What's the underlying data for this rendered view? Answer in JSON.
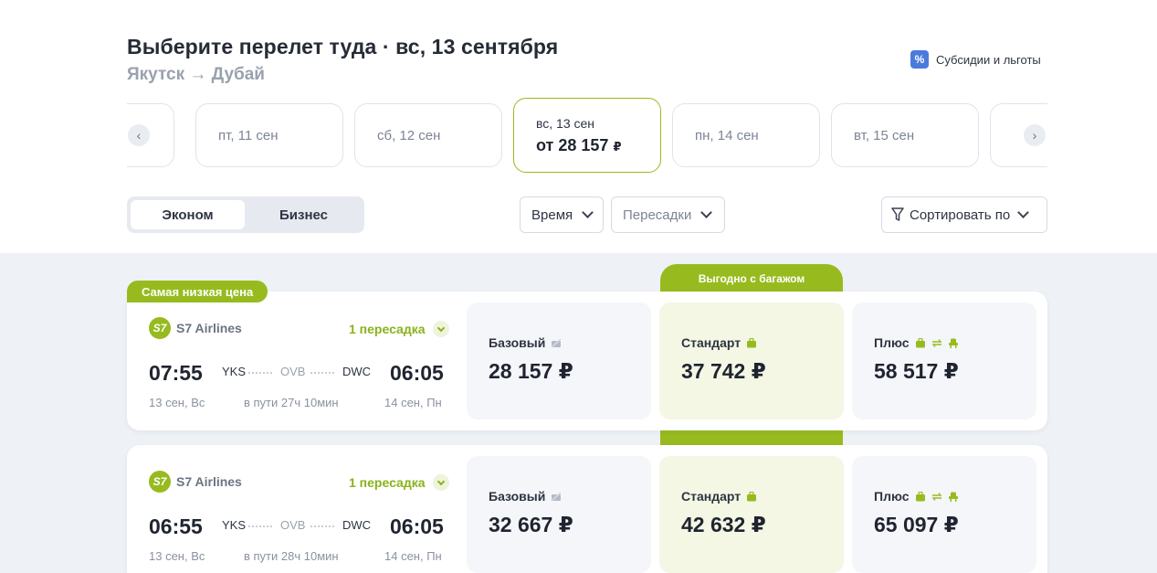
{
  "header": {
    "title": "Выберите перелет туда · вс, 13 сентября",
    "route_from": "Якутск",
    "route_arrow": "→",
    "route_to": "Дубай",
    "subsidy_icon": "%",
    "subsidy_label": "Субсидии и льготы"
  },
  "dates": [
    {
      "label": "пт, 11 сен"
    },
    {
      "label": "сб, 12 сен"
    },
    {
      "label": "вс, 13 сен",
      "price_prefix": "от",
      "price": "28 157",
      "currency": "₽",
      "active": true
    },
    {
      "label": "пн, 14 сен"
    },
    {
      "label": "вт, 15 сен"
    }
  ],
  "cabin": {
    "economy": "Эконом",
    "business": "Бизнес"
  },
  "filters": {
    "time": "Время",
    "transfers": "Пересадки",
    "sort": "Сортировать по"
  },
  "badges": {
    "lowest": "Самая низкая цена",
    "best_baggage": "Выгодно с багажом"
  },
  "flights": [
    {
      "airline_logo": "S7",
      "airline": "S7 Airlines",
      "stops": "1 пересадка",
      "dep_time": "07:55",
      "arr_time": "06:05",
      "from": "YKS",
      "via": "OVB",
      "to": "DWC",
      "dep_date": "13 сен, Вс",
      "duration": "в пути 27ч 10мин",
      "arr_date": "14 сен, Пн",
      "fares": [
        {
          "name": "Базовый",
          "price": "28 157 ₽"
        },
        {
          "name": "Стандарт",
          "price": "37 742 ₽"
        },
        {
          "name": "Плюс",
          "price": "58 517 ₽"
        }
      ]
    },
    {
      "airline_logo": "S7",
      "airline": "S7 Airlines",
      "stops": "1 пересадка",
      "dep_time": "06:55",
      "arr_time": "06:05",
      "from": "YKS",
      "via": "OVB",
      "to": "DWC",
      "dep_date": "13 сен, Вс",
      "duration": "в пути 28ч 10мин",
      "arr_date": "14 сен, Пн",
      "fares": [
        {
          "name": "Базовый",
          "price": "32 667 ₽"
        },
        {
          "name": "Стандарт",
          "price": "42 632 ₽"
        },
        {
          "name": "Плюс",
          "price": "65 097 ₽"
        }
      ]
    }
  ],
  "colors": {
    "accent": "#97bb1f",
    "accent_text": "#8ab21a",
    "subsidy": "#4a7bdc"
  }
}
